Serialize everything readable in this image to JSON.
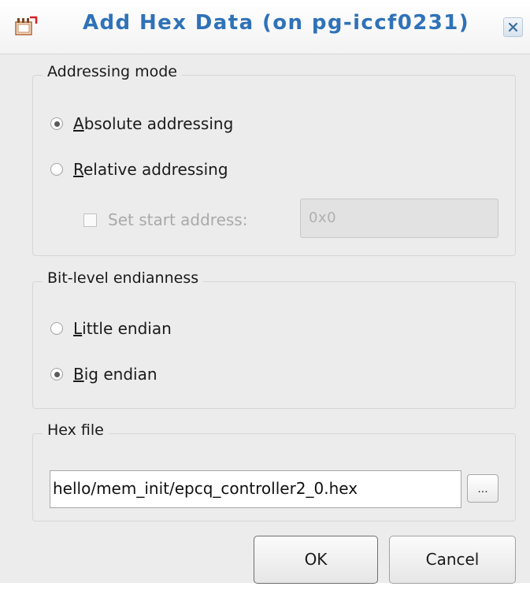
{
  "window": {
    "title": "Add Hex Data (on pg-iccf0231)",
    "icon": "app-icon",
    "close_icon": "close-icon"
  },
  "addressing": {
    "legend": "Addressing mode",
    "absolute_mnemonic": "A",
    "absolute_rest": "bsolute addressing",
    "absolute_selected": true,
    "relative_mnemonic": "R",
    "relative_rest": "elative addressing",
    "relative_selected": false,
    "set_start_label": "Set start address:",
    "set_start_checked": false,
    "start_address_value": "0x0"
  },
  "endianness": {
    "legend": "Bit-level endianness",
    "little_mnemonic": "L",
    "little_rest": "ittle endian",
    "little_selected": false,
    "big_mnemonic": "B",
    "big_rest": "ig endian",
    "big_selected": true
  },
  "hex_file": {
    "legend": "Hex file",
    "path_value": "hello/mem_init/epcq_controller2_0.hex",
    "browse_label": "..."
  },
  "buttons": {
    "ok_label": "OK",
    "cancel_label": "Cancel"
  },
  "colors": {
    "title_text": "#2f72b8",
    "dialog_bg": "#ececec"
  }
}
